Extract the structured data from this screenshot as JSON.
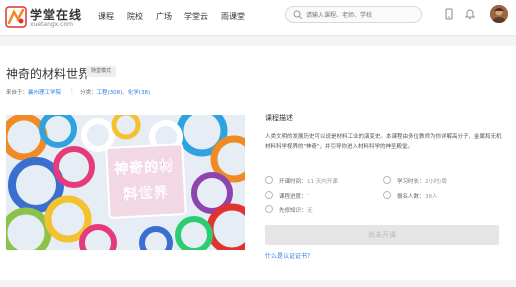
{
  "header": {
    "logo_cn": "学堂在线",
    "logo_en": "xuetangx.com",
    "nav": [
      "课程",
      "院校",
      "广场",
      "学堂云",
      "雨课堂"
    ],
    "search_placeholder": "请输入课程、老师、学校"
  },
  "course": {
    "title": "神奇的材料世界",
    "mode_tag": "随堂模式",
    "source_label": "来自于：",
    "source_value": "襄州理工学院",
    "category_label": "分类：",
    "category_value": "工程(308)、化学(38)",
    "cover_text_line1": "神奇的材",
    "cover_text_line2": "料世界"
  },
  "description": {
    "title": "课程描述",
    "text": "人类文明的发展历史可以说是材料工业的演变史。本课程由多位教师为你详解高分子、金属和无机材料科学视界的\"神奇\"，并引导你进入材料科学的神圣殿堂。"
  },
  "stats": {
    "start_label": "开课时间：",
    "start_value": "11 天内开课",
    "hours_label": "学习时长：",
    "hours_value": "2小时/周",
    "progress_label": "课程进度：",
    "progress_value": "-",
    "enrolled_label": "报名人数：",
    "enrolled_value": "38人",
    "prereq_label": "先修知识：",
    "prereq_value": "无"
  },
  "actions": {
    "not_open": "尚未开课",
    "cert_link": "什么是认证证书？"
  },
  "colors": {
    "link": "#2f7ce6",
    "logo_orange": "#f08a24",
    "logo_red": "#e0322f",
    "cover_text": "#e01e7a"
  }
}
